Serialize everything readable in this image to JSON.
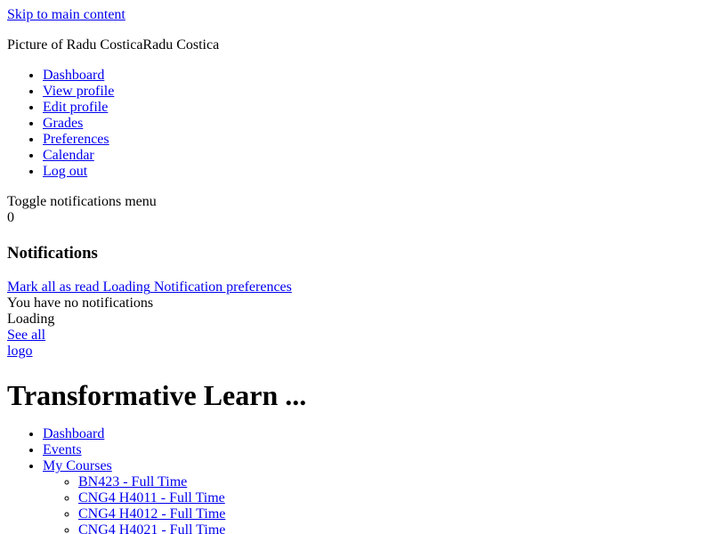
{
  "skip_link": "Skip to main content",
  "user": {
    "avatar_alt": "Picture of Radu Costica",
    "name": "Radu Costica"
  },
  "user_menu": [
    {
      "label": "Dashboard"
    },
    {
      "label": "View profile"
    },
    {
      "label": "Edit profile"
    },
    {
      "label": "Grades"
    },
    {
      "label": "Preferences"
    },
    {
      "label": "Calendar"
    },
    {
      "label": "Log out"
    }
  ],
  "notifications": {
    "toggle_alt": "Toggle notifications menu",
    "count": "0",
    "heading": "Notifications",
    "mark_all_read": "Mark all as read",
    "loading_alt": "Loading",
    "preferences_alt": "Notification preferences",
    "empty_text": "You have no notifications",
    "loading2_alt": "Loading",
    "see_all": "See all"
  },
  "logo_alt": "logo",
  "site_title": "Transformative Learn ...",
  "main_nav": {
    "items": [
      {
        "label": "Dashboard"
      },
      {
        "label": "Events"
      },
      {
        "label": "My Courses"
      }
    ],
    "courses": [
      {
        "label": "BN423 - Full Time"
      },
      {
        "label": "CNG4 H4011 - Full Time"
      },
      {
        "label": "CNG4 H4012 - Full Time"
      },
      {
        "label": "CNG4 H4021 - Full Time"
      }
    ]
  }
}
